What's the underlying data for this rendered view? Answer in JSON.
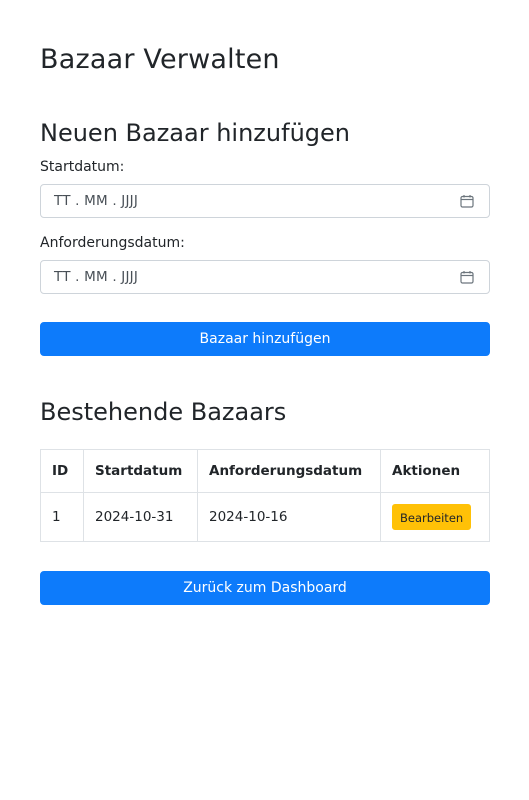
{
  "page": {
    "title": "Bazaar Verwalten"
  },
  "add_form": {
    "heading": "Neuen Bazaar hinzufügen",
    "start_label": "Startdatum:",
    "start_placeholder": "TT . MM . JJJJ",
    "request_label": "Anforderungsdatum:",
    "request_placeholder": "TT . MM . JJJJ",
    "submit_label": "Bazaar hinzufügen",
    "calendar_icon": "calendar-icon"
  },
  "existing": {
    "heading": "Bestehende Bazaars",
    "columns": [
      "ID",
      "Startdatum",
      "Anforderungsdatum",
      "Aktionen"
    ],
    "rows": [
      {
        "id": "1",
        "start": "2024-10-31",
        "request": "2024-10-16",
        "action_label": "Bearbeiten"
      }
    ]
  },
  "back_button_label": "Zurück zum Dashboard",
  "colors": {
    "primary": "#0d7bfb",
    "warning": "#ffc107",
    "text": "#212529",
    "border": "#dee2e6"
  }
}
